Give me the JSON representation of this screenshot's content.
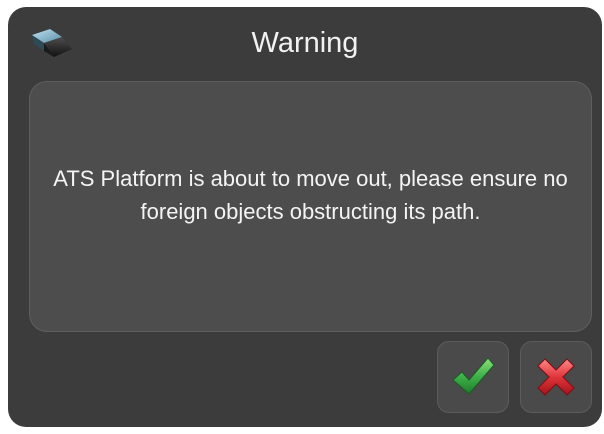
{
  "dialog": {
    "title": "Warning",
    "title_icon": "ats-platform-icon",
    "message": "ATS Platform is about to move out, please ensure no foreign objects obstructing its path.",
    "buttons": {
      "confirm_icon": "checkmark-icon",
      "cancel_icon": "close-x-icon"
    }
  },
  "colors": {
    "frame": "#3c3c3c",
    "panel": "#4d4d4d",
    "text": "#f4f4f4",
    "confirm": "#3fb24a",
    "cancel": "#e0343a"
  }
}
